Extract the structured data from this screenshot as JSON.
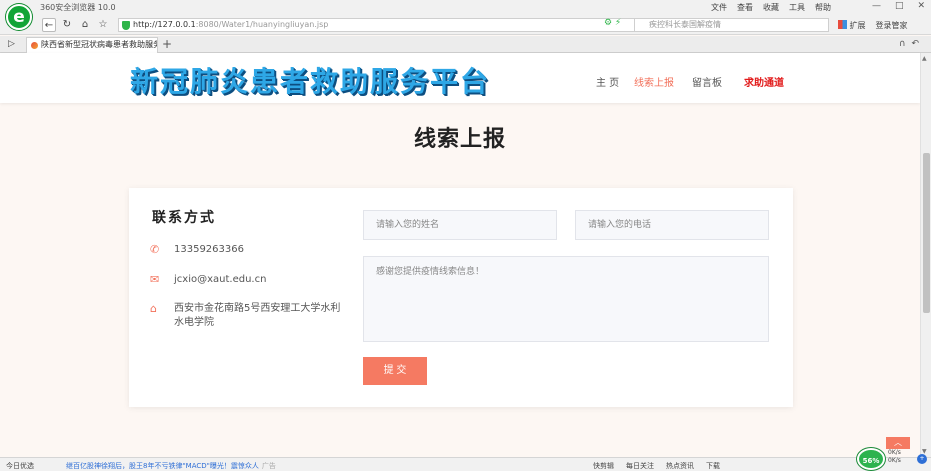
{
  "browser": {
    "app_title": "360安全浏览器 10.0",
    "logo_letter": "e",
    "menu": [
      "文件",
      "查看",
      "收藏",
      "工具",
      "帮助"
    ],
    "win_controls": [
      "—",
      "□",
      "✕"
    ],
    "url_host": "http://127.0.0.1",
    "url_path": ":8080/Water1/huanyingliuyan.jsp",
    "search_text": "疾控科长泰国解疫情",
    "ext_label": "扩展",
    "login_label": "登录管家",
    "tab_title": "陕西省新型冠状病毒患者救助服务平台",
    "tab_close": "×",
    "tab_new": "+"
  },
  "site": {
    "logo_text": "新冠肺炎患者救助服务平台",
    "nav": {
      "home": "主 页",
      "report": "线索上报",
      "board": "留言板",
      "help": "求助通道"
    },
    "page_title": "线索上报"
  },
  "contact": {
    "title": "联系方式",
    "phone": "13359263366",
    "email": "jcxio@xaut.edu.cn",
    "address": "西安市金花南路5号西安理工大学水利水电学院"
  },
  "form": {
    "name_placeholder": "请输入您的姓名",
    "phone_placeholder": "请输入您的电话",
    "message_placeholder": "感谢您提供疫情线索信息！",
    "submit_label": "提 交"
  },
  "statusbar": {
    "left": "今日优选",
    "news": "继百亿股神徐翔后，股王8年不亏铁律\"MACD\"曝光！震惊众人",
    "news_tag": "广告",
    "items": [
      "快剪辑",
      "每日关注",
      "热点资讯",
      "下载"
    ],
    "gauge": "56%",
    "speed_up": "0K/s",
    "speed_down": "0K/s"
  },
  "colors": {
    "accent": "#f57a62",
    "help_red": "#e21b1b",
    "logo_blue": "#2ea7e6"
  }
}
